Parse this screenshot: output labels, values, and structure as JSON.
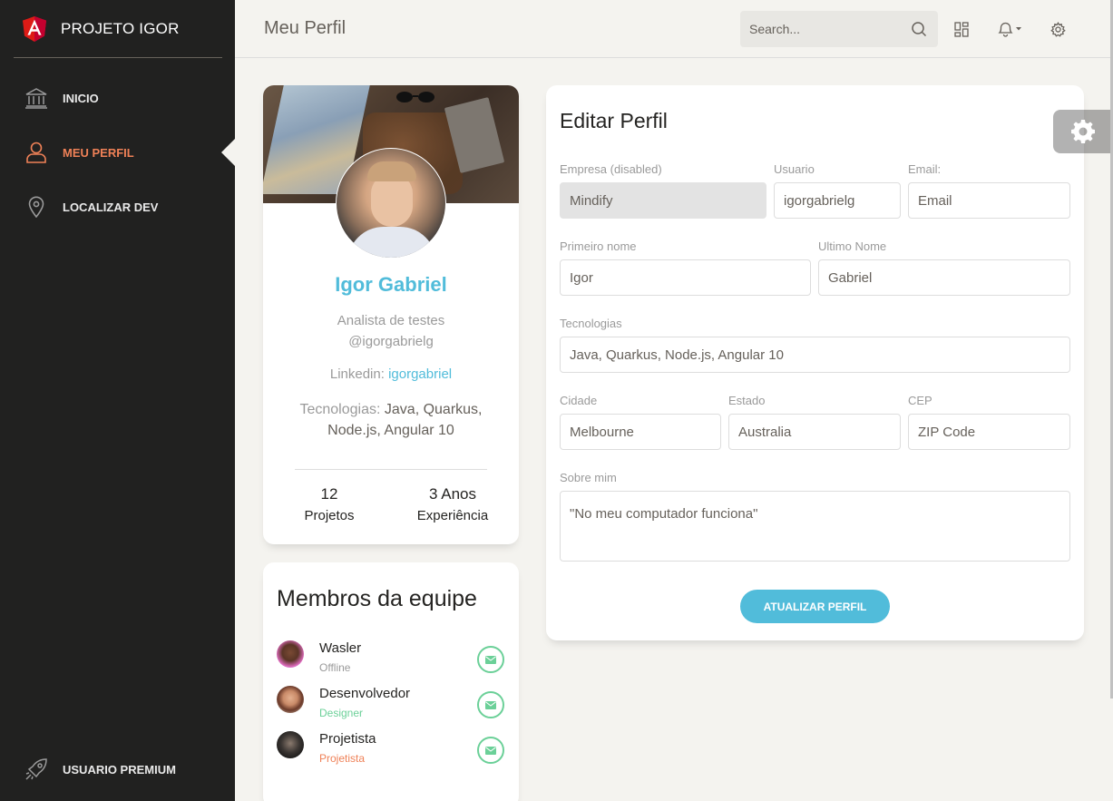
{
  "brand": {
    "name": "PROJETO IGOR",
    "logo_icon": "angular-logo-icon"
  },
  "sidebar": {
    "items": [
      {
        "label": "INICIO",
        "icon": "bank-icon",
        "active": false
      },
      {
        "label": "MEU PERFIL",
        "icon": "user-icon",
        "active": true
      },
      {
        "label": "LOCALIZAR DEV",
        "icon": "map-pin-icon",
        "active": false
      }
    ],
    "bottom_item": {
      "label": "USUARIO PREMIUM",
      "icon": "rocket-icon"
    }
  },
  "topbar": {
    "title": "Meu Perfil",
    "search_placeholder": "Search...",
    "icons": [
      "search-icon",
      "dashboard-icon",
      "bell-icon",
      "gear-icon"
    ]
  },
  "profile": {
    "name": "Igor Gabriel",
    "role": "Analista de testes",
    "handle": "@igorgabrielg",
    "linkedin_label": "Linkedin:",
    "linkedin_value": "igorgabriel",
    "tech_label": "Tecnologias:",
    "tech_value": "Java, Quarkus, Node.js, Angular 10",
    "stats": [
      {
        "value": "12",
        "label": "Projetos"
      },
      {
        "value": "3 Anos",
        "label": "Experiência"
      }
    ]
  },
  "team": {
    "title": "Membros da equipe",
    "members": [
      {
        "name": "Wasler",
        "status": "Offline",
        "status_color": "#9a9a9a"
      },
      {
        "name": "Desenvolvedor",
        "status": "Designer",
        "status_color": "#6bd098"
      },
      {
        "name": "Projetista",
        "status": "Projetista",
        "status_color": "#ef8157"
      }
    ]
  },
  "edit": {
    "title": "Editar Perfil",
    "company": {
      "label": "Empresa (disabled)",
      "value": "Mindify"
    },
    "username": {
      "label": "Usuario",
      "value": "igorgabrielg"
    },
    "email": {
      "label": "Email:",
      "placeholder": "Email"
    },
    "first_name": {
      "label": "Primeiro nome",
      "value": "Igor"
    },
    "last_name": {
      "label": "Ultimo Nome",
      "value": "Gabriel"
    },
    "technologies": {
      "label": "Tecnologias",
      "value": "Java, Quarkus, Node.js, Angular 10"
    },
    "city": {
      "label": "Cidade",
      "value": "Melbourne"
    },
    "state": {
      "label": "Estado",
      "value": "Australia"
    },
    "zip": {
      "label": "CEP",
      "placeholder": "ZIP Code"
    },
    "about": {
      "label": "Sobre mim",
      "value": "\"No meu computador funciona\""
    },
    "submit_label": "ATUALIZAR PERFIL"
  },
  "colors": {
    "accent": "#51bcda",
    "active_nav": "#ef8157",
    "success": "#6bd098",
    "sidebar_bg": "#212120",
    "page_bg": "#f4f3ef"
  }
}
